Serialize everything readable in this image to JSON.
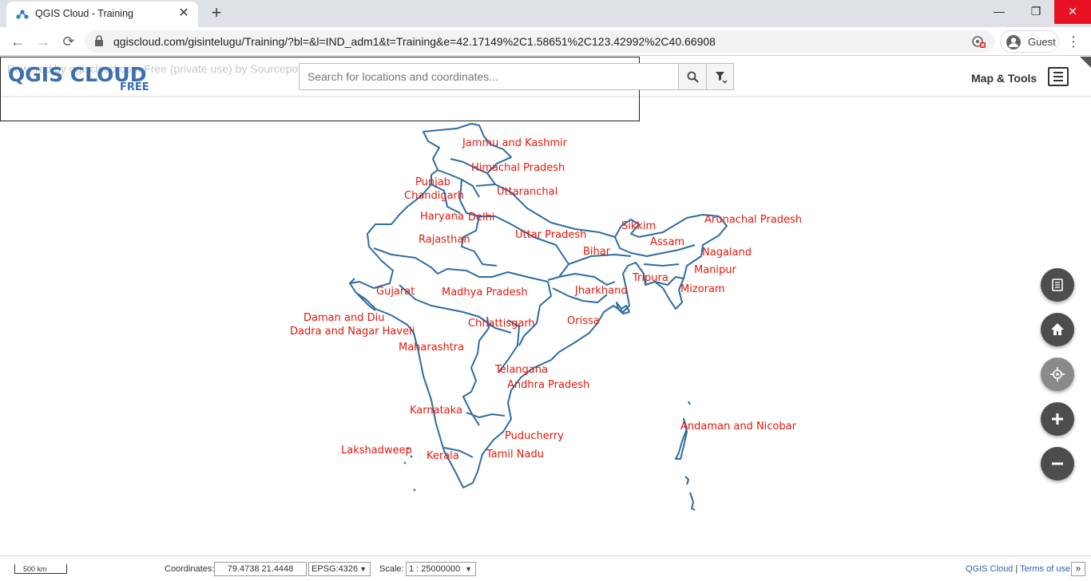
{
  "browser": {
    "tab_title": "QGIS Cloud - Training",
    "url": "qgiscloud.com/gisintelugu/Training/?bl=&l=IND_adm1&t=Training&e=42.17149%2C1.58651%2C123.42992%2C40.66908",
    "profile": "Guest"
  },
  "header": {
    "powered_text": "Powered by qgiscloud.com Free (private use) by Sourcepole",
    "logo_main": "QGIS CLOUD",
    "logo_sub": "FREE",
    "search_placeholder": "Search for locations and coordinates...",
    "map_tools_label": "Map & Tools"
  },
  "map": {
    "states": [
      "Jammu and Kashmir",
      "Himachal Pradesh",
      "Punjab",
      "Chandigarh",
      "Uttaranchal",
      "Haryana",
      "Delhi",
      "Rajasthan",
      "Uttar Pradesh",
      "Sikkim",
      "Arunachal Pradesh",
      "Assam",
      "Bihar",
      "Nagaland",
      "Manipur",
      "Tripura",
      "Gujarat",
      "Madhya Pradesh",
      "Jharkhand",
      "Mizoram",
      "Daman and Diu",
      "Dadra and Nagar Haveli",
      "Orissa",
      "Chhattisgarh",
      "Maharashtra",
      "Telangana",
      "Andhra Pradesh",
      "Karnataka",
      "Andaman and Nicobar",
      "Puducherry",
      "Lakshadweep",
      "Kerala",
      "Tamil Nadu"
    ],
    "boundary_color": "#2e6ca4",
    "label_color": "#e3170a"
  },
  "footer": {
    "scale_bar": "500 km",
    "coordinates_label": "Coordinates:",
    "coordinates_value": "79.4738 21.4448",
    "crs": "EPSG:4326",
    "scale_label": "Scale:",
    "scale_value": "1 : 25000000",
    "link_qgis": "QGIS Cloud",
    "link_separator": "|",
    "link_terms": "Terms of use",
    "expand": "»"
  }
}
